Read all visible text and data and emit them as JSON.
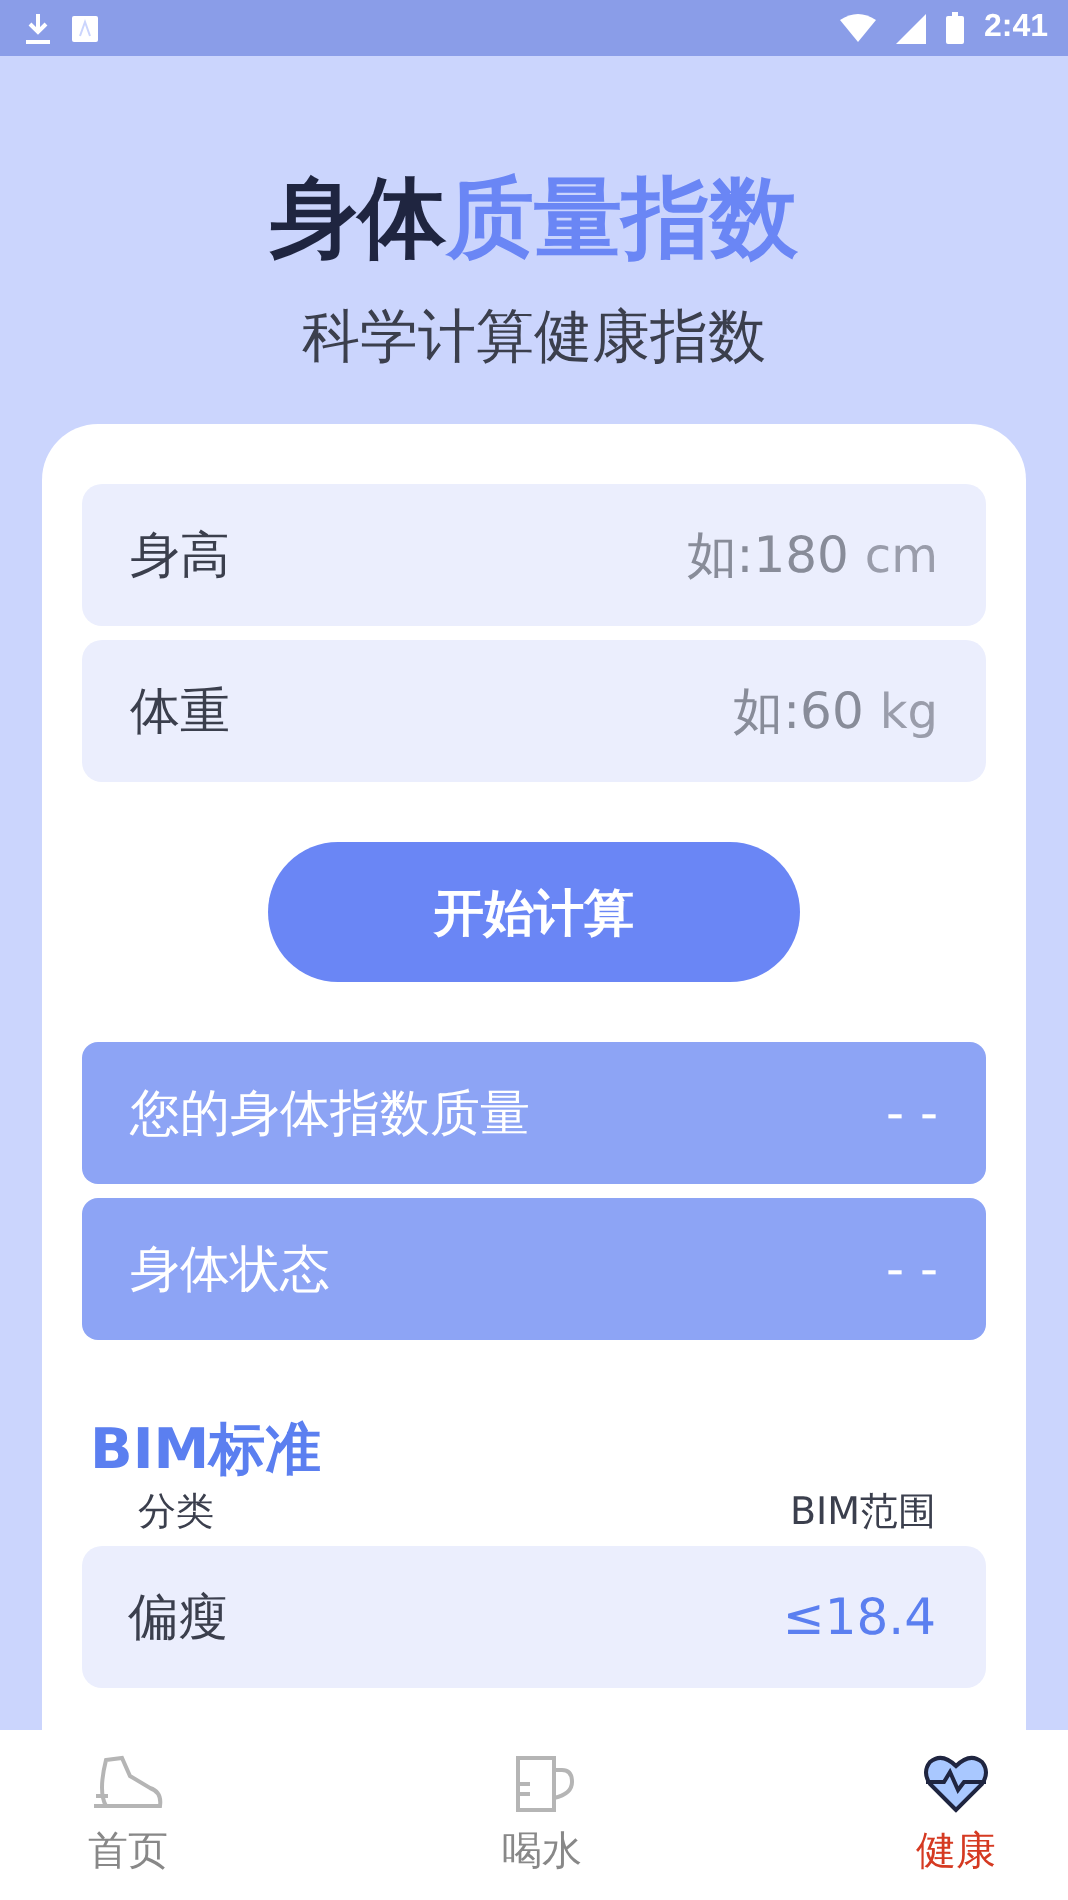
{
  "status_bar": {
    "time": "2:41"
  },
  "header": {
    "title_dark": "身体",
    "title_accent": "质量指数",
    "subtitle": "科学计算健康指数"
  },
  "inputs": [
    {
      "label": "身高",
      "placeholder": "如:180",
      "unit": "cm"
    },
    {
      "label": "体重",
      "placeholder": "如:60",
      "unit": "kg"
    }
  ],
  "calculate_button": "开始计算",
  "results": [
    {
      "label": "您的身体指数质量",
      "value": "- -"
    },
    {
      "label": "身体状态",
      "value": "- -"
    }
  ],
  "standard": {
    "title": "BIM标准",
    "columns": [
      "分类",
      "BIM范围"
    ],
    "rows": [
      {
        "category": "偏瘦",
        "range": "≤18.4"
      }
    ]
  },
  "nav": [
    {
      "label": "首页",
      "selected": false
    },
    {
      "label": "喝水",
      "selected": false
    },
    {
      "label": "健康",
      "selected": true
    }
  ]
}
